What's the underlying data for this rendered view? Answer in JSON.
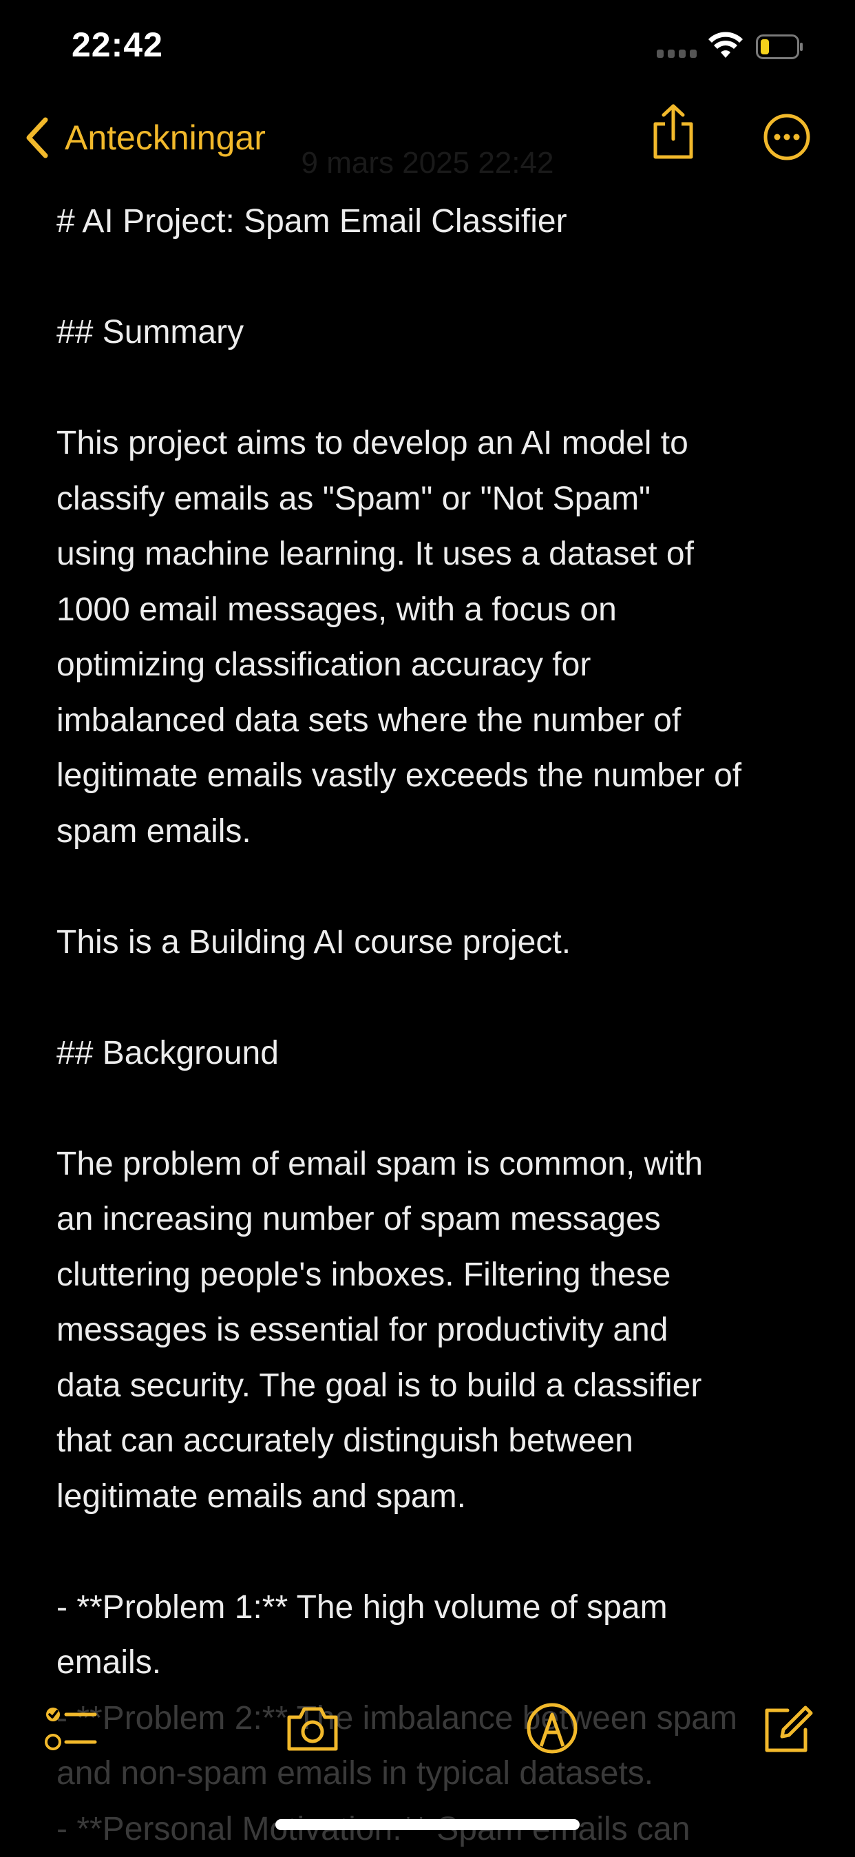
{
  "status_bar": {
    "time": "22:42"
  },
  "nav": {
    "back_label": "Anteckningar",
    "date": "9 mars 2025 22:42"
  },
  "note": {
    "lines": [
      "# AI Project: Spam Email Classifier",
      "",
      "## Summary",
      "",
      "This project aims to develop an AI model to",
      "classify emails as \"Spam\" or \"Not Spam\"",
      "using machine learning. It uses a dataset of",
      "1000 email messages, with a focus on",
      "optimizing classification accuracy for",
      "imbalanced data sets where the number of",
      "legitimate emails vastly exceeds the number of",
      "spam emails.",
      "",
      "This is a Building AI course project.",
      "",
      "## Background",
      "",
      "The problem of email spam is common, with",
      "an increasing number of spam messages",
      "cluttering people's inboxes. Filtering these",
      "messages is essential for productivity and",
      "data security. The goal is to build a classifier",
      "that can accurately distinguish between",
      "legitimate emails and spam.",
      "",
      "- **Problem 1:** The high volume of spam",
      "emails.",
      "- **Problem 2:** The imbalance between spam",
      "and non-spam emails in typical datasets.",
      "- **Personal Motivation:** Spam emails can"
    ]
  },
  "colors": {
    "accent": "#F2B92B",
    "background": "#000000",
    "text": "#ECECEC"
  },
  "icons": {
    "back": "chevron-left-icon",
    "share": "share-icon",
    "more": "ellipsis-circle-icon",
    "checklist": "checklist-icon",
    "camera": "camera-icon",
    "markup": "pen-circle-icon",
    "compose": "compose-icon"
  }
}
